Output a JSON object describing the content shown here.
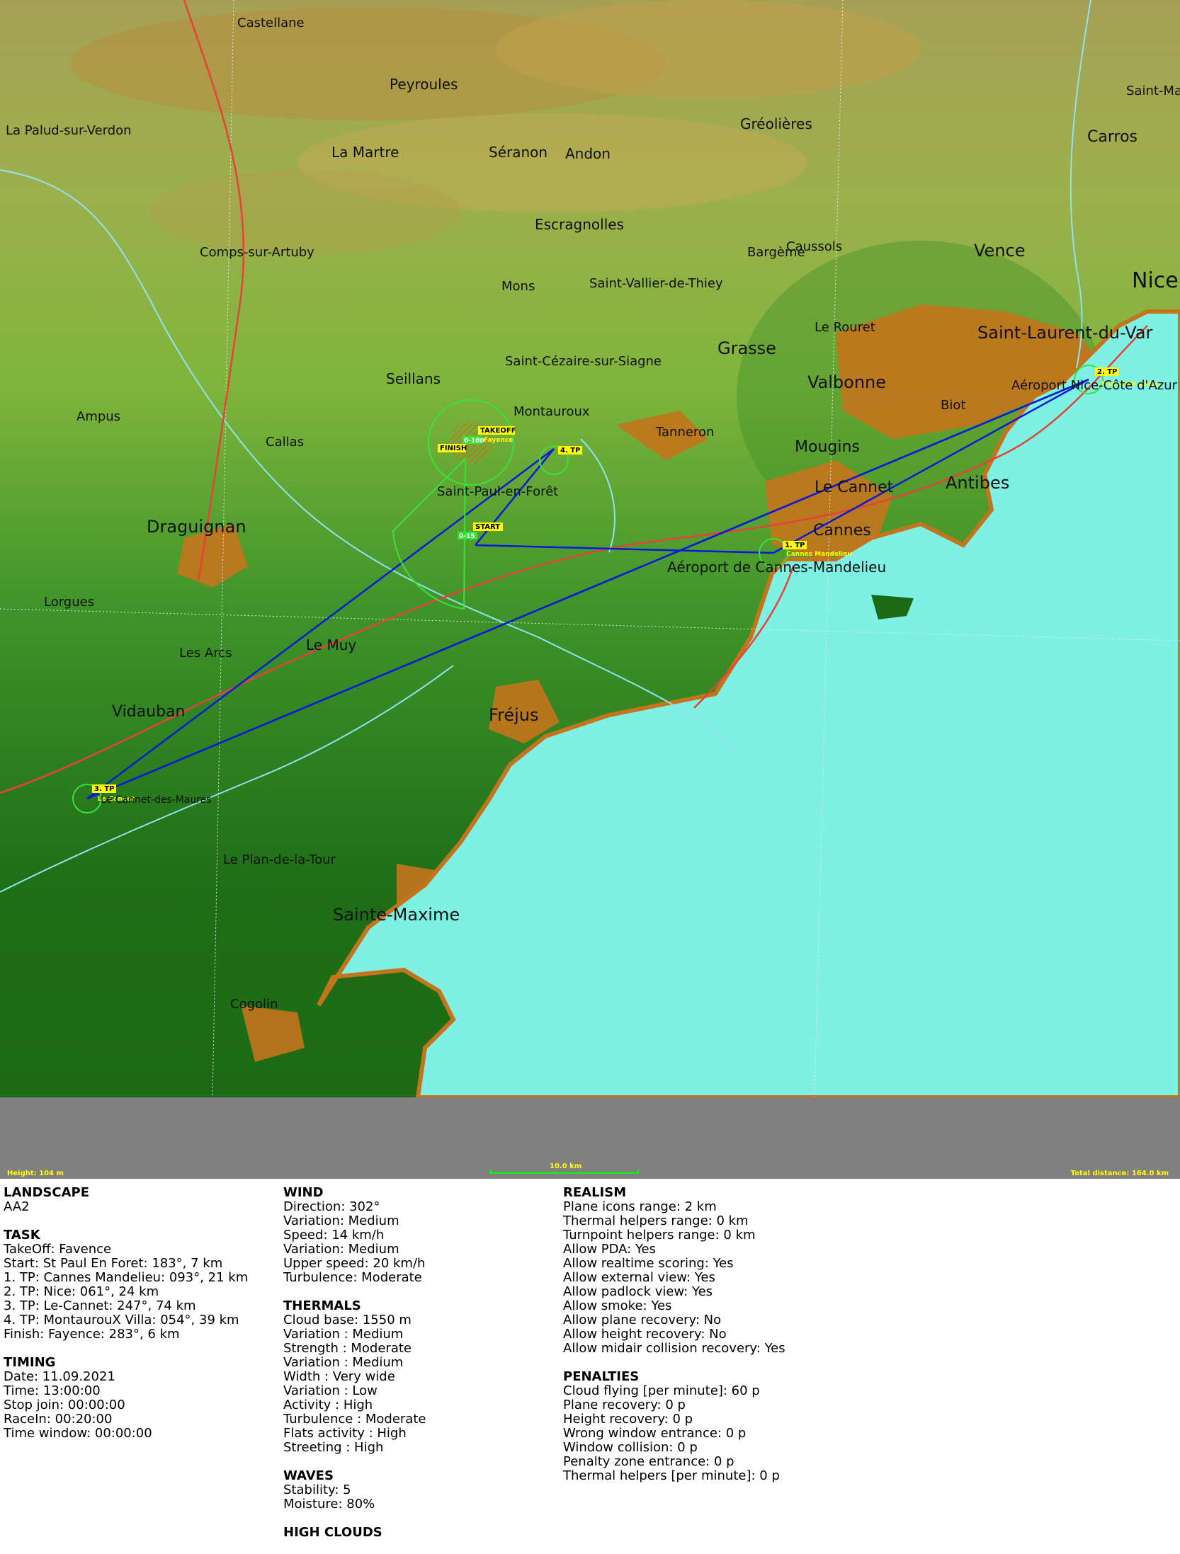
{
  "map": {
    "colors": {
      "sea": "#7ff0e4",
      "coast": "#c4741c",
      "route": "#0a1ad8",
      "zone": "#39e23a",
      "tp_label": "#ffff00"
    },
    "towns": [
      "Castellane",
      "Peyroules",
      "La Palud-sur-Verdon",
      "La Martre",
      "Séranon",
      "Andon",
      "Gréolières",
      "Saint-Martin-du-Var",
      "Carros",
      "Escragnolles",
      "Bargème",
      "Comps-sur-Artuby",
      "Saint-Vallier-de-Thiey",
      "Mons",
      "Caussols",
      "Vence",
      "Nice",
      "Saint-Laurent-du-Var",
      "Le Rouret",
      "Grasse",
      "Saint-Cézaire-sur-Siagne",
      "Seillans",
      "Valbonne",
      "Biot",
      "Aéroport Nice-Côte d'Azur",
      "Ampus",
      "Montauroux",
      "Callas",
      "Tanneron",
      "Mougins",
      "Le Cannet",
      "Antibes",
      "Saint-Paul-en-Forêt",
      "Draguignan",
      "Cannes",
      "Aéroport de Cannes-Mandelieu",
      "Lorgues",
      "Les Arcs",
      "Le Muy",
      "Vidauban",
      "Fréjus",
      "Le Cannet-des-Maures",
      "Le Plan-de-la-Tour",
      "Sainte-Maxime",
      "Cogolin"
    ],
    "waypoint_labels": [
      "TAKEOFF",
      "FINISH",
      "START",
      "1. TP",
      "2. TP",
      "3. TP",
      "4. TP"
    ],
    "zone_tags": [
      "0-100",
      "0-15"
    ],
    "point_names": [
      "Fayence",
      "Cannes Mandelieu",
      "Nice-Côte d'Azur",
      "Le-Cannet"
    ],
    "height_readout": "Height: 104 m",
    "scale_label": "10.0 km",
    "total_distance": "Total distance: 164.0 km"
  },
  "info": {
    "landscape": {
      "title": "LANDSCAPE",
      "lines": [
        "AA2"
      ]
    },
    "task": {
      "title": "TASK",
      "lines": [
        "TakeOff: Favence",
        "Start: St Paul En Foret: 183°, 7 km",
        "1. TP: Cannes Mandelieu: 093°, 21 km",
        "2. TP: Nice: 061°, 24 km",
        "3. TP: Le-Cannet: 247°, 74 km",
        "4. TP: MontaurouX Villa: 054°, 39 km",
        "Finish: Fayence: 283°, 6 km"
      ]
    },
    "timing": {
      "title": "TIMING",
      "lines": [
        "Date: 11.09.2021",
        "Time: 13:00:00",
        "Stop join: 00:00:00",
        "RaceIn: 00:20:00",
        "Time window: 00:00:00"
      ]
    },
    "wind": {
      "title": "WIND",
      "lines": [
        "Direction: 302°",
        "Variation: Medium",
        "Speed: 14 km/h",
        "Variation: Medium",
        "Upper speed: 20 km/h",
        "Turbulence: Moderate"
      ]
    },
    "thermals": {
      "title": "THERMALS",
      "lines": [
        "Cloud base: 1550 m",
        "Variation : Medium",
        "Strength : Moderate",
        "Variation : Medium",
        "Width : Very wide",
        "Variation : Low",
        "Activity : High",
        "Turbulence : Moderate",
        "Flats activity : High",
        "Streeting : High"
      ]
    },
    "waves": {
      "title": "WAVES",
      "lines": [
        "Stability: 5",
        "Moisture: 80%"
      ]
    },
    "high_clouds": {
      "title": "HIGH CLOUDS"
    },
    "realism": {
      "title": "REALISM",
      "lines": [
        "Plane icons range: 2 km",
        "Thermal helpers range: 0 km",
        "Turnpoint helpers range: 0 km",
        "Allow PDA: Yes",
        "Allow realtime scoring: Yes",
        "Allow external view: Yes",
        "Allow padlock view: Yes",
        "Allow smoke: Yes",
        "Allow plane recovery: No",
        "Allow height recovery: No",
        "Allow midair collision recovery: Yes"
      ]
    },
    "penalties": {
      "title": "PENALTIES",
      "lines": [
        "Cloud flying [per minute]: 60 p",
        "Plane recovery: 0 p",
        "Height recovery: 0 p",
        "Wrong window entrance: 0 p",
        "Window collision: 0 p",
        "Penalty zone entrance: 0 p",
        "Thermal helpers [per minute]: 0 p"
      ]
    }
  }
}
